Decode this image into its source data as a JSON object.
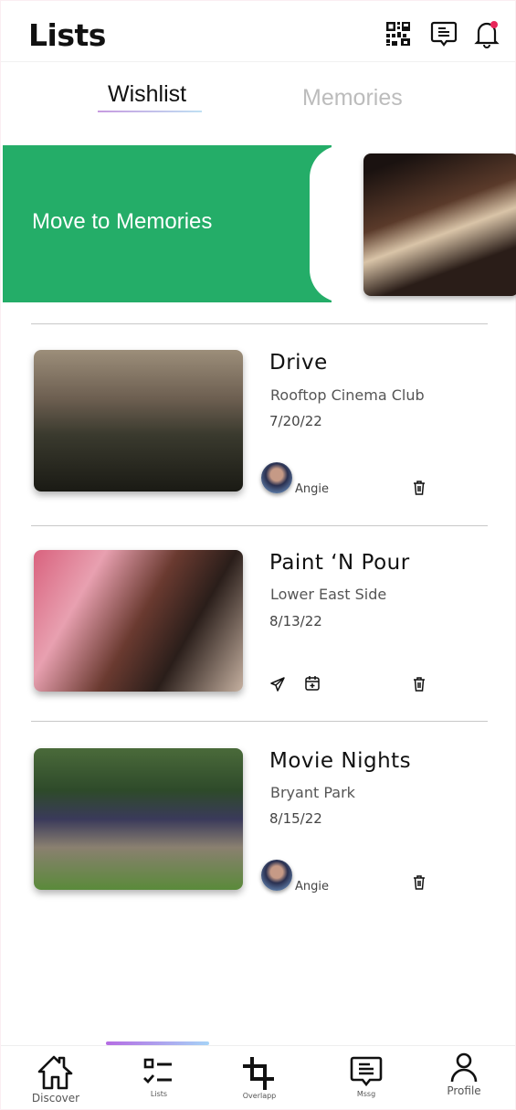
{
  "header": {
    "title": "Lists",
    "icons": [
      "qr-code-icon",
      "message-icon",
      "bell-icon"
    ],
    "notification_dot_color": "#e8265a"
  },
  "tabs": [
    {
      "label": "Wishlist",
      "active": true
    },
    {
      "label": "Memories",
      "active": false
    }
  ],
  "swipe_action": {
    "label": "Move to Memories",
    "color": "#24ad68"
  },
  "items": [
    {
      "title": "Drive",
      "venue": "Rooftop Cinema Club",
      "date": "7/20/22",
      "user": "Angie"
    },
    {
      "title": "Paint ‘N Pour",
      "venue": "Lower East Side",
      "date": "8/13/22"
    },
    {
      "title": "Movie Nights",
      "venue": "Bryant Park",
      "date": "8/15/22",
      "user": "Angie"
    }
  ],
  "nav": [
    {
      "label": "Discover"
    },
    {
      "label": "Lists",
      "active": true
    },
    {
      "label": "Overlapp"
    },
    {
      "label": "Mssg"
    },
    {
      "label": "Profile"
    }
  ]
}
